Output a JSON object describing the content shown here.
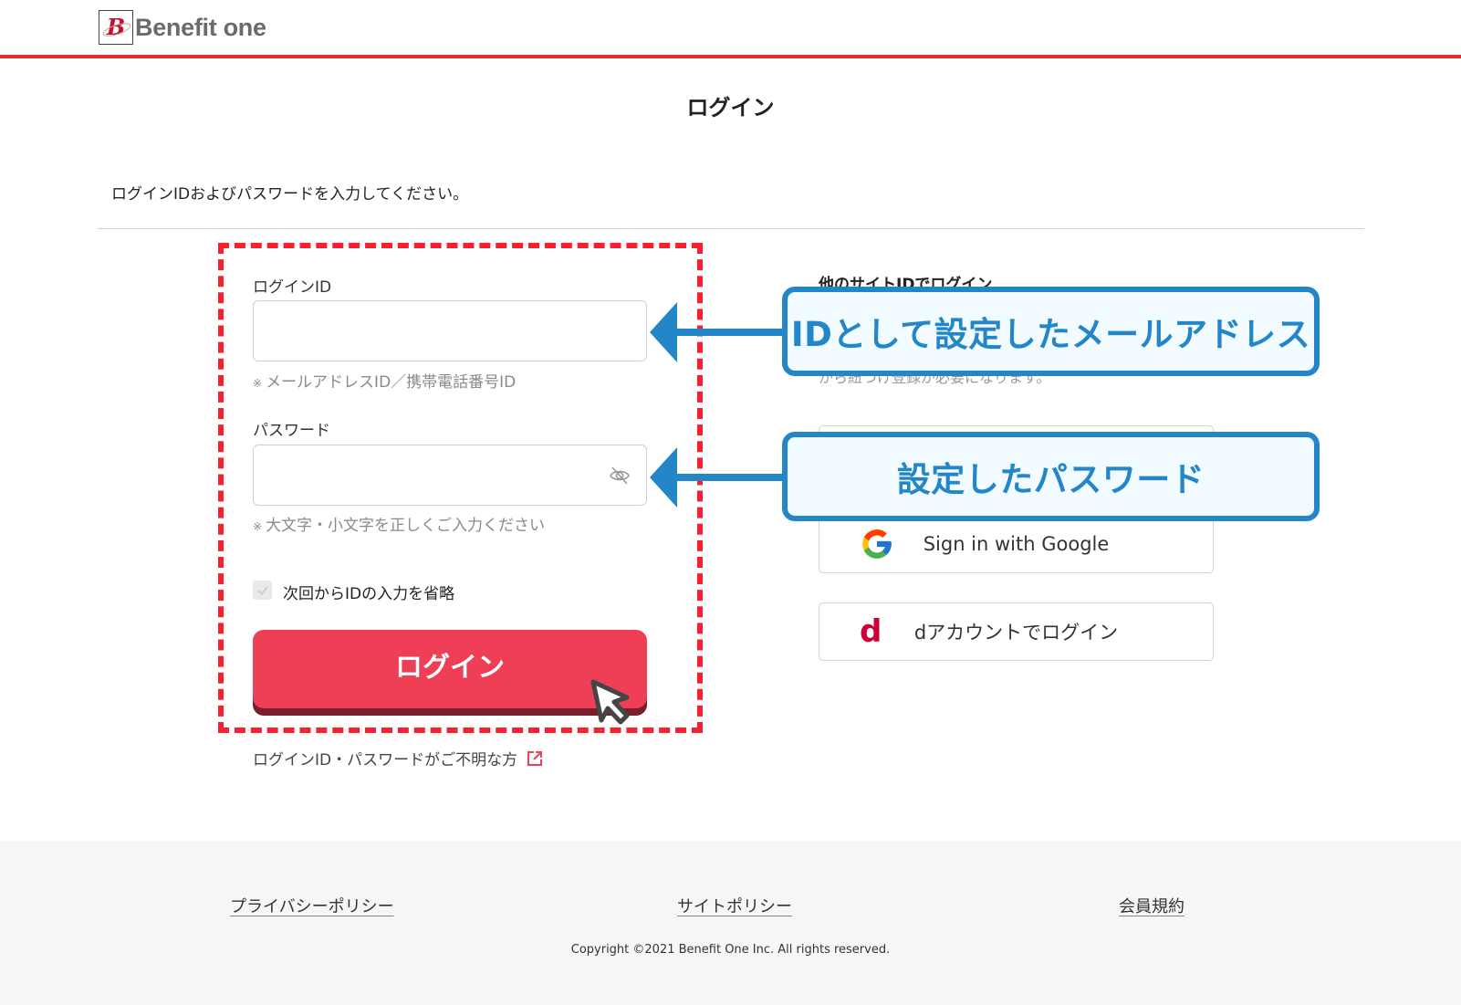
{
  "header": {
    "logo_mark": "B",
    "logo_text": "Benefit one",
    "accent_color": "#e0302a"
  },
  "page": {
    "title": "ログイン",
    "intro": "ログインIDおよびパスワードを入力してください。"
  },
  "form": {
    "login_id": {
      "label": "ログインID",
      "value": "",
      "placeholder": "",
      "hint_mark": "※",
      "hint": "メールアドレスID／携帯電話番号ID"
    },
    "password": {
      "label": "パスワード",
      "value": "",
      "placeholder": "",
      "hint_mark": "※",
      "hint": "大文字・小文字を正しくご入力ください",
      "toggle_icon": "eye-off-icon"
    },
    "remember": {
      "label": "次回からIDの入力を省略",
      "checked": false
    },
    "submit_label": "ログイン",
    "submit_color": "#ee3f57",
    "forgot_link": "ログインID・パスワードがご不明な方",
    "forgot_icon": "external-link-icon"
  },
  "social": {
    "title": "他のサイトIDでログイン",
    "note": "から紐づけ登録が必要になります。",
    "buttons": [
      {
        "label": "Sign in with Google",
        "icon": "google-icon"
      },
      {
        "label": "dアカウントでログイン",
        "icon": "d-account-icon",
        "icon_text": "d"
      }
    ]
  },
  "annotations": {
    "callouts": [
      {
        "text": "IDとして設定したメールアドレス"
      },
      {
        "text": "設定したパスワード"
      }
    ],
    "callout_color": "#2386c8",
    "highlight_color": "#f5212f"
  },
  "footer": {
    "links": [
      "プライバシーポリシー",
      "サイトポリシー",
      "会員規約"
    ],
    "copyright": "Copyright ©2021 Benefit One Inc. All rights reserved."
  }
}
